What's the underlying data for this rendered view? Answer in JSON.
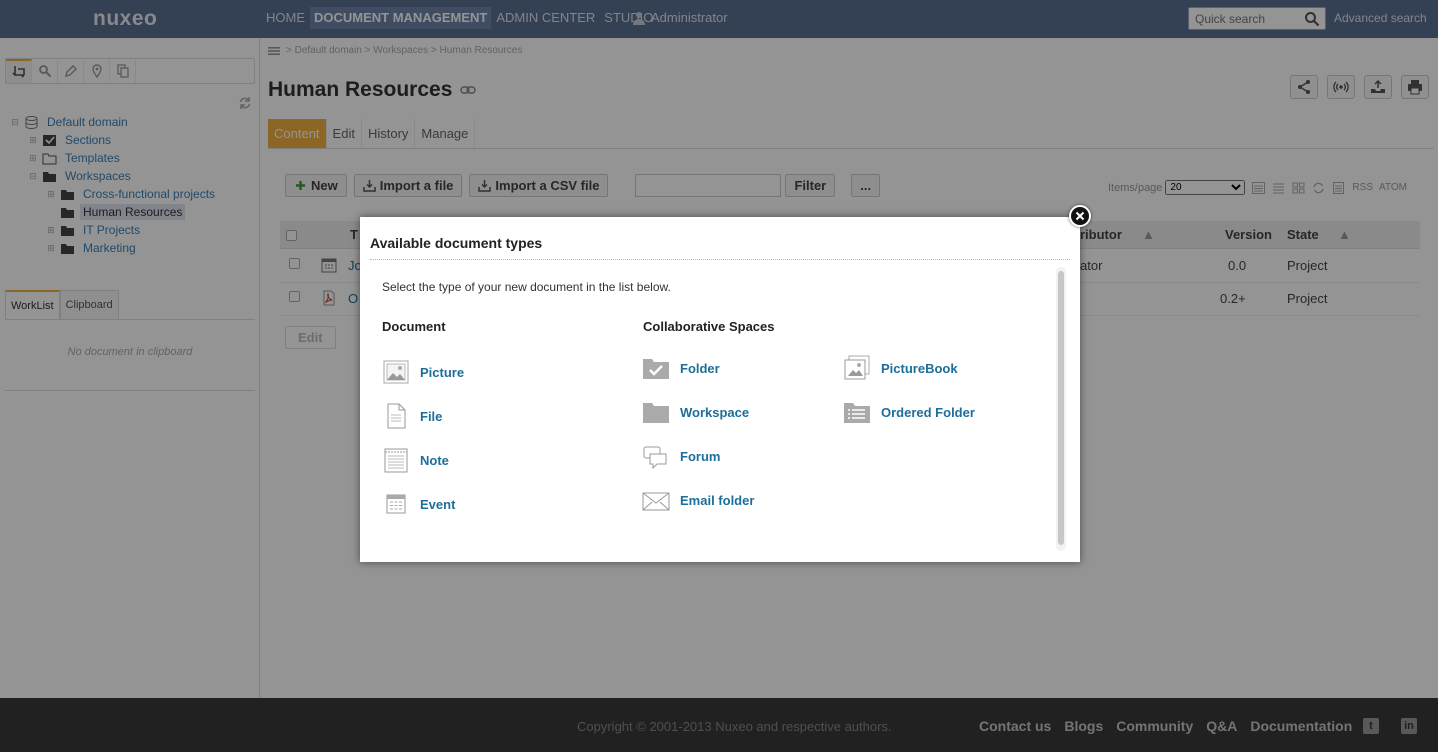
{
  "topbar": {
    "logo": "nuxeo",
    "nav": [
      "HOME",
      "DOCUMENT MANAGEMENT",
      "ADMIN CENTER",
      "STUDIO"
    ],
    "user": "Administrator",
    "search_placeholder": "Quick search",
    "advanced_search": "Advanced search"
  },
  "sidebar": {
    "tree": [
      {
        "label": "Default domain",
        "icon": "database-icon"
      },
      {
        "label": "Sections",
        "icon": "sections-icon"
      },
      {
        "label": "Templates",
        "icon": "folder-icon"
      },
      {
        "label": "Workspaces",
        "icon": "folder-icon"
      },
      {
        "label": "Cross-functional projects",
        "icon": "folder-icon"
      },
      {
        "label": "Human Resources",
        "icon": "folder-icon"
      },
      {
        "label": "IT Projects",
        "icon": "folder-icon"
      },
      {
        "label": "Marketing",
        "icon": "folder-icon"
      }
    ],
    "worklist_tabs": [
      "WorkList",
      "Clipboard"
    ],
    "clipboard_empty": "No document in clipboard"
  },
  "main": {
    "breadcrumb": [
      "Default domain",
      "Workspaces",
      "Human Resources"
    ],
    "title": "Human Resources",
    "tabs": [
      "Content",
      "Edit",
      "History",
      "Manage"
    ],
    "toolbar": {
      "new": "New",
      "import_file": "Import a file",
      "import_csv": "Import a CSV file",
      "filter": "Filter",
      "more": "..."
    },
    "items_per_page_label": "Items/page",
    "items_per_page_value": "20",
    "feeds": [
      "RSS",
      "ATOM"
    ],
    "table": {
      "headers": [
        "T",
        "ributor",
        "Version",
        "State"
      ],
      "rows": [
        {
          "title": "Jo",
          "contributor": "ator",
          "version": "0.0",
          "state": "Project"
        },
        {
          "title": "O",
          "contributor": "",
          "version": "0.2+",
          "state": "Project"
        }
      ]
    },
    "edit_button": "Edit"
  },
  "footer": {
    "copyright": "Copyright © 2001-2013 Nuxeo and respective authors.",
    "links": [
      "Contact us",
      "Blogs",
      "Community",
      "Q&A",
      "Documentation"
    ]
  },
  "modal": {
    "title": "Available document types",
    "intro": "Select the type of your new document in the list below.",
    "categories": [
      "Document",
      "Collaborative Spaces"
    ],
    "document_types": [
      {
        "label": "Picture",
        "icon": "picture-icon"
      },
      {
        "label": "File",
        "icon": "file-icon"
      },
      {
        "label": "Note",
        "icon": "note-icon"
      },
      {
        "label": "Event",
        "icon": "event-icon"
      }
    ],
    "collab_types": [
      {
        "label": "Folder",
        "icon": "folder-check-icon"
      },
      {
        "label": "Workspace",
        "icon": "workspace-icon"
      },
      {
        "label": "Forum",
        "icon": "forum-icon"
      },
      {
        "label": "Email folder",
        "icon": "email-folder-icon"
      }
    ],
    "collab_types_col2": [
      {
        "label": "PictureBook",
        "icon": "picturebook-icon"
      },
      {
        "label": "Ordered Folder",
        "icon": "ordered-folder-icon"
      }
    ]
  },
  "colors": {
    "topbar": "#5a6e91",
    "accent": "#f0b03f",
    "link": "#1d6e99",
    "footer": "#3a3a3a"
  }
}
